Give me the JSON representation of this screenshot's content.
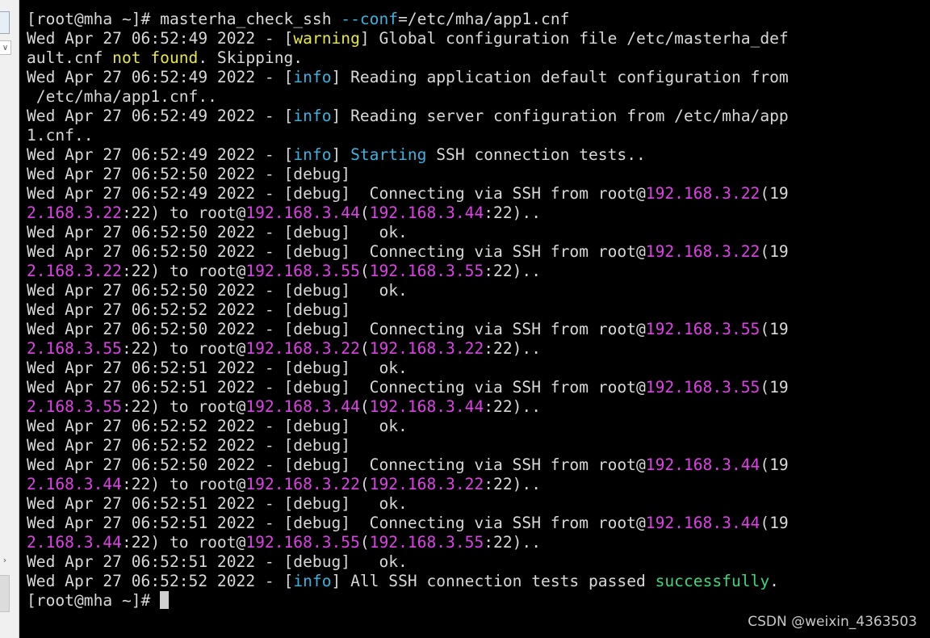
{
  "colors": {
    "terminal_bg": "#000000",
    "text_default": "#d8d8d8",
    "warning": "#e8e844",
    "info": "#3bb3e0",
    "ip": "#e040e8",
    "success": "#3fd67a"
  },
  "sidebar": {
    "chevron_down_icon": "chevron-down-icon",
    "chevron_right_icon": "chevron-right-icon"
  },
  "terminal": {
    "lines": [
      [
        {
          "t": "[root@mha ~]# masterha_check_ssh "
        },
        {
          "t": "--conf",
          "c": "cyan"
        },
        {
          "t": "=/etc/mha/app1.cnf"
        }
      ],
      [
        {
          "t": "Wed Apr 27 06:52:49 2022 - ["
        },
        {
          "t": "warning",
          "c": "yellow"
        },
        {
          "t": "] Global configuration file /etc/masterha_def"
        }
      ],
      [
        {
          "t": "ault.cnf "
        },
        {
          "t": "not found",
          "c": "yellow"
        },
        {
          "t": ". Skipping."
        }
      ],
      [
        {
          "t": "Wed Apr 27 06:52:49 2022 - ["
        },
        {
          "t": "info",
          "c": "cyan"
        },
        {
          "t": "] Reading application default configuration from"
        }
      ],
      [
        {
          "t": " /etc/mha/app1.cnf.."
        }
      ],
      [
        {
          "t": "Wed Apr 27 06:52:49 2022 - ["
        },
        {
          "t": "info",
          "c": "cyan"
        },
        {
          "t": "] Reading server configuration from /etc/mha/app"
        }
      ],
      [
        {
          "t": "1.cnf.."
        }
      ],
      [
        {
          "t": "Wed Apr 27 06:52:49 2022 - ["
        },
        {
          "t": "info",
          "c": "cyan"
        },
        {
          "t": "] "
        },
        {
          "t": "Starting",
          "c": "cyan"
        },
        {
          "t": " SSH connection tests.."
        }
      ],
      [
        {
          "t": "Wed Apr 27 06:52:50 2022 - [debug]"
        }
      ],
      [
        {
          "t": "Wed Apr 27 06:52:49 2022 - [debug]  Connecting via SSH from root@"
        },
        {
          "t": "192.168.3.22",
          "c": "magenta"
        },
        {
          "t": "(19"
        }
      ],
      [
        {
          "t": "2.168.3.22",
          "c": "magenta"
        },
        {
          "t": ":22) to root@"
        },
        {
          "t": "192.168.3.44",
          "c": "magenta"
        },
        {
          "t": "("
        },
        {
          "t": "192.168.3.44",
          "c": "magenta"
        },
        {
          "t": ":22).."
        }
      ],
      [
        {
          "t": "Wed Apr 27 06:52:50 2022 - [debug]   ok."
        }
      ],
      [
        {
          "t": "Wed Apr 27 06:52:50 2022 - [debug]  Connecting via SSH from root@"
        },
        {
          "t": "192.168.3.22",
          "c": "magenta"
        },
        {
          "t": "(19"
        }
      ],
      [
        {
          "t": "2.168.3.22",
          "c": "magenta"
        },
        {
          "t": ":22) to root@"
        },
        {
          "t": "192.168.3.55",
          "c": "magenta"
        },
        {
          "t": "("
        },
        {
          "t": "192.168.3.55",
          "c": "magenta"
        },
        {
          "t": ":22).."
        }
      ],
      [
        {
          "t": "Wed Apr 27 06:52:50 2022 - [debug]   ok."
        }
      ],
      [
        {
          "t": "Wed Apr 27 06:52:52 2022 - [debug]"
        }
      ],
      [
        {
          "t": "Wed Apr 27 06:52:50 2022 - [debug]  Connecting via SSH from root@"
        },
        {
          "t": "192.168.3.55",
          "c": "magenta"
        },
        {
          "t": "(19"
        }
      ],
      [
        {
          "t": "2.168.3.55",
          "c": "magenta"
        },
        {
          "t": ":22) to root@"
        },
        {
          "t": "192.168.3.22",
          "c": "magenta"
        },
        {
          "t": "("
        },
        {
          "t": "192.168.3.22",
          "c": "magenta"
        },
        {
          "t": ":22).."
        }
      ],
      [
        {
          "t": "Wed Apr 27 06:52:51 2022 - [debug]   ok."
        }
      ],
      [
        {
          "t": "Wed Apr 27 06:52:51 2022 - [debug]  Connecting via SSH from root@"
        },
        {
          "t": "192.168.3.55",
          "c": "magenta"
        },
        {
          "t": "(19"
        }
      ],
      [
        {
          "t": "2.168.3.55",
          "c": "magenta"
        },
        {
          "t": ":22) to root@"
        },
        {
          "t": "192.168.3.44",
          "c": "magenta"
        },
        {
          "t": "("
        },
        {
          "t": "192.168.3.44",
          "c": "magenta"
        },
        {
          "t": ":22).."
        }
      ],
      [
        {
          "t": "Wed Apr 27 06:52:52 2022 - [debug]   ok."
        }
      ],
      [
        {
          "t": "Wed Apr 27 06:52:52 2022 - [debug]"
        }
      ],
      [
        {
          "t": "Wed Apr 27 06:52:50 2022 - [debug]  Connecting via SSH from root@"
        },
        {
          "t": "192.168.3.44",
          "c": "magenta"
        },
        {
          "t": "(19"
        }
      ],
      [
        {
          "t": "2.168.3.44",
          "c": "magenta"
        },
        {
          "t": ":22) to root@"
        },
        {
          "t": "192.168.3.22",
          "c": "magenta"
        },
        {
          "t": "("
        },
        {
          "t": "192.168.3.22",
          "c": "magenta"
        },
        {
          "t": ":22).."
        }
      ],
      [
        {
          "t": "Wed Apr 27 06:52:51 2022 - [debug]   ok."
        }
      ],
      [
        {
          "t": "Wed Apr 27 06:52:51 2022 - [debug]  Connecting via SSH from root@"
        },
        {
          "t": "192.168.3.44",
          "c": "magenta"
        },
        {
          "t": "(19"
        }
      ],
      [
        {
          "t": "2.168.3.44",
          "c": "magenta"
        },
        {
          "t": ":22) to root@"
        },
        {
          "t": "192.168.3.55",
          "c": "magenta"
        },
        {
          "t": "("
        },
        {
          "t": "192.168.3.55",
          "c": "magenta"
        },
        {
          "t": ":22).."
        }
      ],
      [
        {
          "t": "Wed Apr 27 06:52:51 2022 - [debug]   ok."
        }
      ],
      [
        {
          "t": "Wed Apr 27 06:52:52 2022 - ["
        },
        {
          "t": "info",
          "c": "cyan"
        },
        {
          "t": "] All SSH connection tests passed "
        },
        {
          "t": "successfully",
          "c": "green"
        },
        {
          "t": "."
        }
      ]
    ],
    "prompt": "[root@mha ~]# "
  },
  "watermark": "CSDN @weixin_4363503"
}
